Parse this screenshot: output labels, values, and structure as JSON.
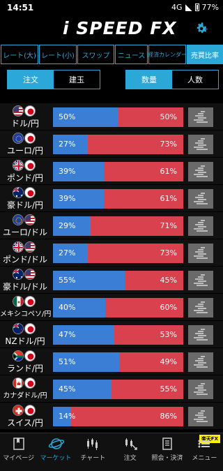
{
  "status": {
    "time": "14:51",
    "network": "4G",
    "battery": "77%"
  },
  "app": {
    "logo": "i SPEED FX"
  },
  "tabs": [
    {
      "label": "レート(大)",
      "active": false
    },
    {
      "label": "レート(小)",
      "active": false
    },
    {
      "label": "スワップ",
      "active": false
    },
    {
      "label": "ニュース",
      "active": false
    },
    {
      "label": "経済カレンダー",
      "active": false
    },
    {
      "label": "売買比率",
      "active": true
    }
  ],
  "segments": {
    "left": [
      {
        "label": "注文",
        "active": true
      },
      {
        "label": "建玉",
        "active": false
      }
    ],
    "right": [
      {
        "label": "数量",
        "active": true
      },
      {
        "label": "人数",
        "active": false
      }
    ]
  },
  "pairs": [
    {
      "name": "ドル/円",
      "flags": [
        "US",
        "JP"
      ],
      "buy": 50,
      "sell": 50
    },
    {
      "name": "ユーロ/円",
      "flags": [
        "EU",
        "JP"
      ],
      "buy": 27,
      "sell": 73
    },
    {
      "name": "ポンド/円",
      "flags": [
        "GB",
        "JP"
      ],
      "buy": 39,
      "sell": 61
    },
    {
      "name": "豪ドル/円",
      "flags": [
        "AU",
        "JP"
      ],
      "buy": 39,
      "sell": 61
    },
    {
      "name": "ユーロ/ドル",
      "flags": [
        "EU",
        "US"
      ],
      "buy": 29,
      "sell": 71
    },
    {
      "name": "ポンド/ドル",
      "flags": [
        "GB",
        "US"
      ],
      "buy": 27,
      "sell": 73
    },
    {
      "name": "豪ドル/ドル",
      "flags": [
        "AU",
        "US"
      ],
      "buy": 55,
      "sell": 45
    },
    {
      "name": "メキシコペソ/円",
      "flags": [
        "MX",
        "JP"
      ],
      "buy": 40,
      "sell": 60
    },
    {
      "name": "NZドル/円",
      "flags": [
        "NZ",
        "JP"
      ],
      "buy": 47,
      "sell": 53
    },
    {
      "name": "ランド/円",
      "flags": [
        "ZA",
        "JP"
      ],
      "buy": 51,
      "sell": 49
    },
    {
      "name": "カナダドル/円",
      "flags": [
        "CA",
        "JP"
      ],
      "buy": 45,
      "sell": 55
    },
    {
      "name": "スイス/円",
      "flags": [
        "CH",
        "JP"
      ],
      "buy": 14,
      "sell": 86
    }
  ],
  "bottom_nav": [
    {
      "label": "マイページ",
      "icon": "book-icon",
      "active": false
    },
    {
      "label": "マーケット",
      "icon": "globe-icon",
      "active": true
    },
    {
      "label": "チャート",
      "icon": "candlestick-icon",
      "active": false
    },
    {
      "label": "注文",
      "icon": "order-icon",
      "active": false
    },
    {
      "label": "照会・決済",
      "icon": "document-icon",
      "active": false
    },
    {
      "label": "メニュー",
      "icon": "menu-icon",
      "active": false
    }
  ],
  "rakuten_badge": "楽天FX",
  "colors": {
    "accent": "#2ba8d8",
    "buy": "#3b7ed6",
    "sell": "#d9414e"
  }
}
